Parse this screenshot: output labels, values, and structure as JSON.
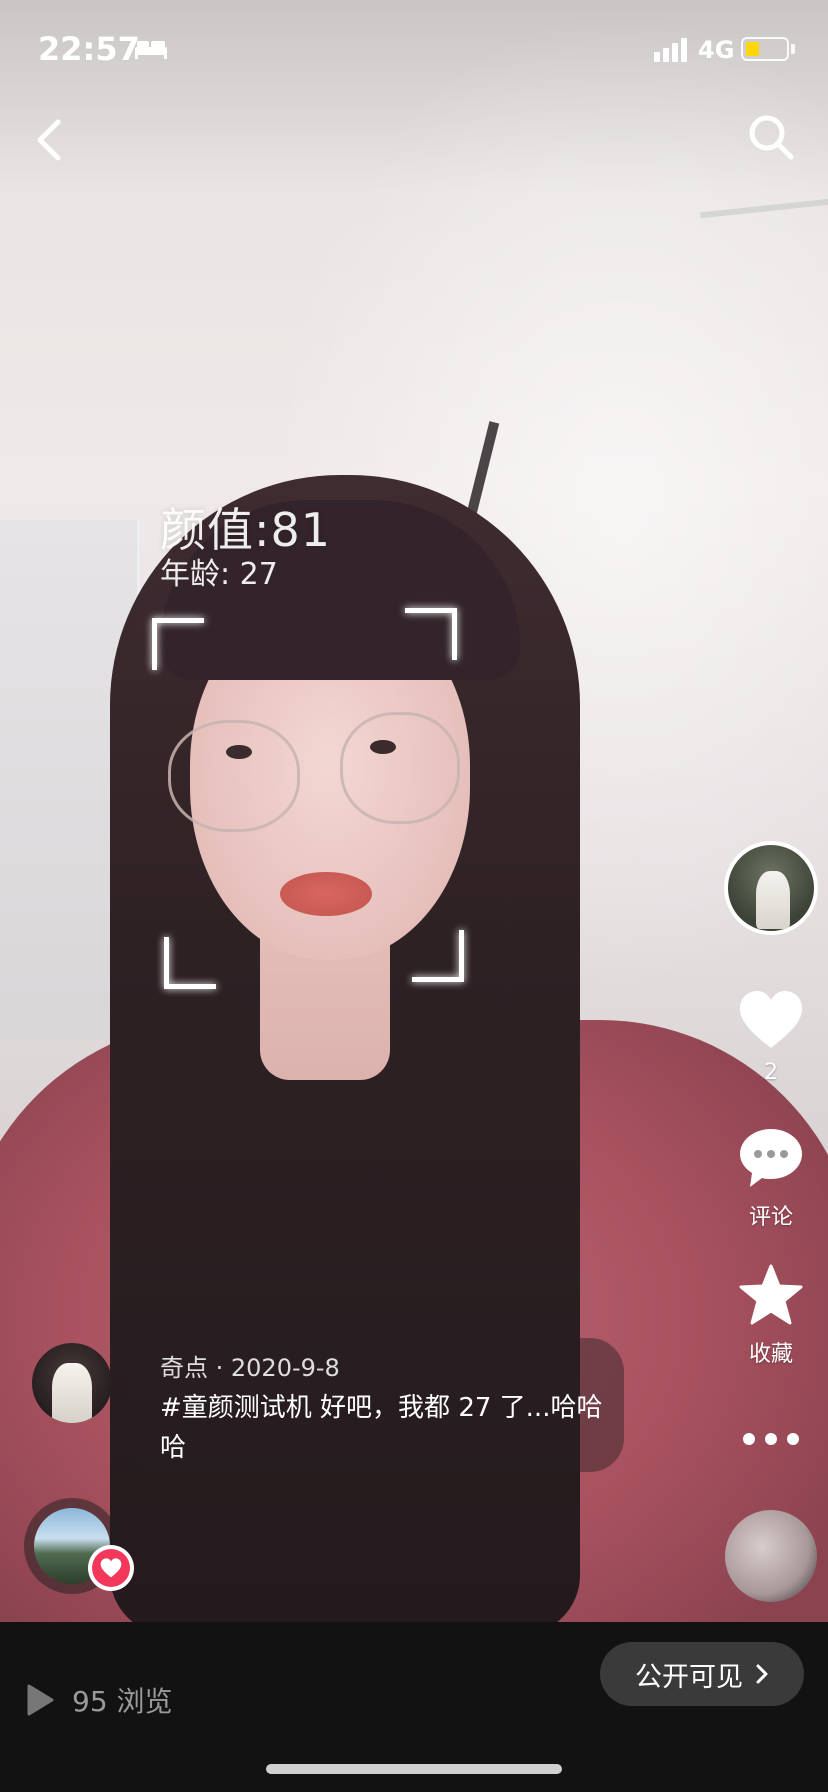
{
  "status_bar": {
    "time": "22:57",
    "network": "4G",
    "battery_level": 0.35,
    "battery_color": "#ffd60a",
    "icons": [
      "bed-icon",
      "signal-icon",
      "battery-icon"
    ]
  },
  "nav": {
    "back_icon": "chevron-left-icon",
    "search_icon": "search-icon"
  },
  "video_overlay": {
    "score_text": "颜值:81",
    "age_text": "年龄: 27"
  },
  "actions": {
    "like_count": "2",
    "comment_label": "评论",
    "favorite_label": "收藏",
    "icons": [
      "heart-icon",
      "comment-icon",
      "star-icon",
      "more-icon"
    ]
  },
  "post": {
    "author_meta": "奇点 · 2020-9-8",
    "caption": "#童颜测试机 好吧，我都 27 了...哈哈哈",
    "accent_color": "#f2375b"
  },
  "footer": {
    "views_text": "95 浏览",
    "visibility_label": "公开可见"
  }
}
